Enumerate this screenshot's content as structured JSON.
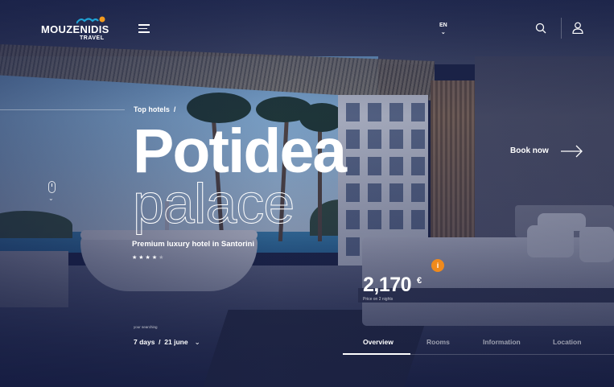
{
  "brand": {
    "name": "MOUZENIDIS",
    "sub": "TRAVEL",
    "colors": {
      "mark_blue": "#1fa3d6",
      "mark_orange": "#f39a1e",
      "accent": "#f08a1c"
    }
  },
  "header": {
    "language": "EN",
    "icons": [
      "hamburger-menu-icon",
      "chevron-down-icon",
      "search-icon",
      "user-icon"
    ]
  },
  "hero": {
    "breadcrumb": "Top hotels",
    "breadcrumb_sep": "/",
    "title_line1": "Potidea",
    "title_line2": "palace",
    "subtitle": "Premium luxury hotel in Santorini",
    "stars_filled": 4,
    "stars_total": 5,
    "stars_filled_text": "★★★★",
    "stars_empty_text": "★"
  },
  "booking": {
    "label": "Book now"
  },
  "price": {
    "amount": "2,170",
    "currency": "€",
    "note": "Price on 2 nights",
    "info": "i"
  },
  "search": {
    "label": "your searching",
    "value": "7 days  /  21 june",
    "chevron": "⌄"
  },
  "tabs": [
    {
      "label": "Overview",
      "active": true
    },
    {
      "label": "Rooms",
      "active": false
    },
    {
      "label": "Information",
      "active": false
    },
    {
      "label": "Location",
      "active": false
    }
  ]
}
